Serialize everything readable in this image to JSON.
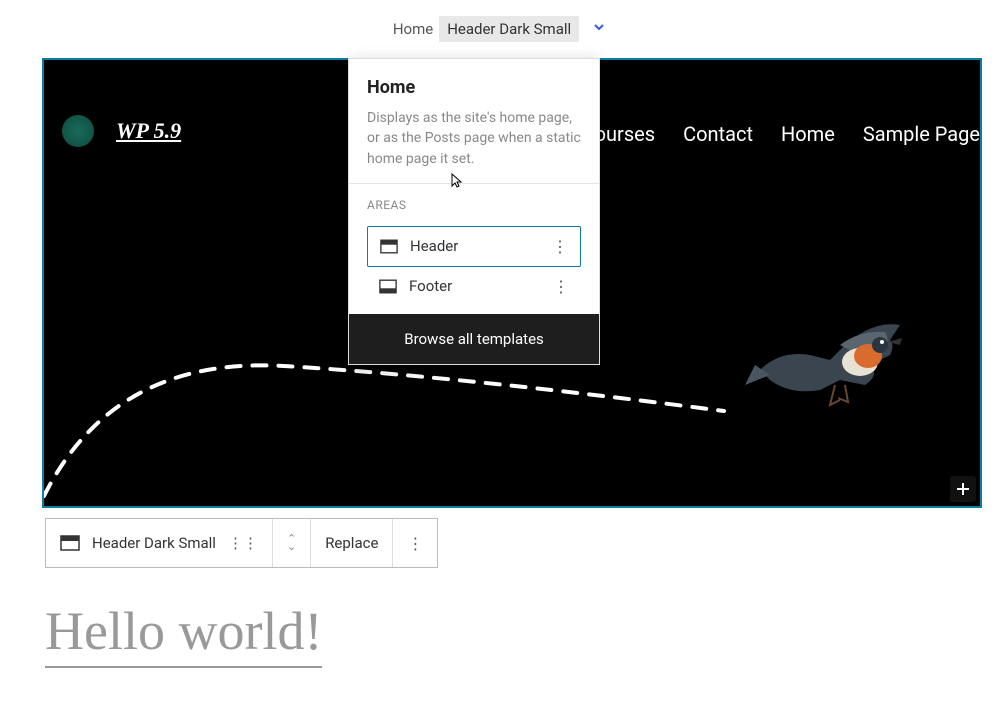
{
  "breadcrumb": {
    "home": "Home",
    "current": "Header Dark Small"
  },
  "header": {
    "site_title": "WP 5.9",
    "nav_items": [
      "All Courses",
      "Contact",
      "Home",
      "Sample Page"
    ]
  },
  "dropdown": {
    "title": "Home",
    "description": "Displays as the site's home page, or as the Posts page when a static home page it set.",
    "areas_label": "AREAS",
    "areas": [
      {
        "label": "Header",
        "selected": true
      },
      {
        "label": "Footer",
        "selected": false
      }
    ],
    "browse_label": "Browse all templates"
  },
  "toolbar": {
    "block_name": "Header Dark Small",
    "replace_label": "Replace"
  },
  "post": {
    "title": "Hello world!"
  },
  "colors": {
    "selection": "#0a7ea4",
    "dark": "#1e1e1e"
  }
}
